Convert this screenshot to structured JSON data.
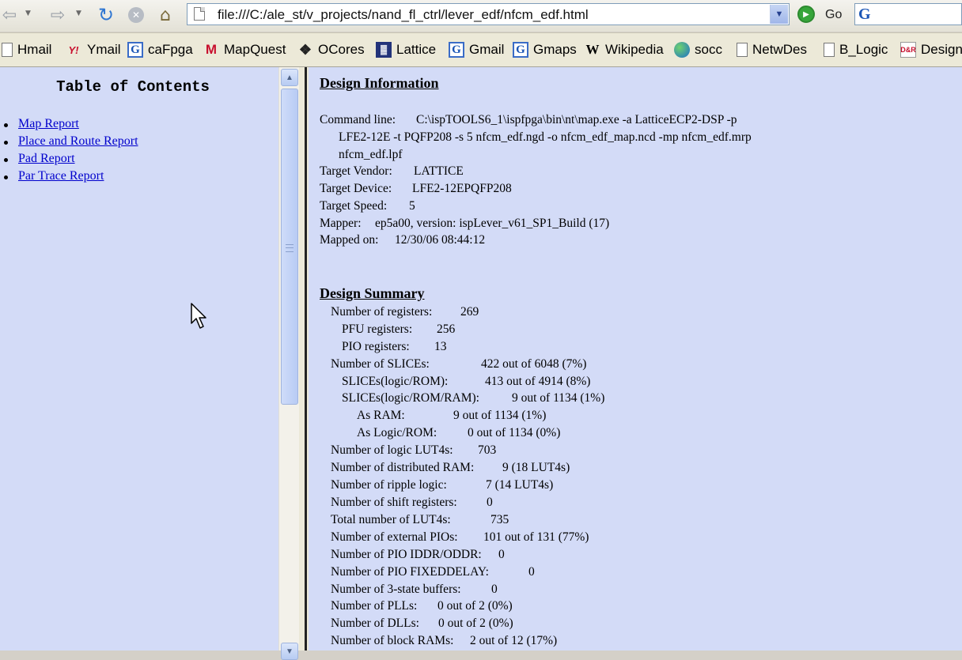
{
  "browser": {
    "url": "file:///C:/ale_st/v_projects/nand_fl_ctrl/lever_edf/nfcm_edf.html",
    "go_label": "Go",
    "back_icon": "back-arrow-icon",
    "forward_icon": "forward-arrow-icon",
    "reload_icon": "reload-icon",
    "stop_icon": "stop-icon",
    "home_icon": "home-icon"
  },
  "bookmarks": [
    {
      "label": "Hmail",
      "icon": "page-icon"
    },
    {
      "label": "Ymail",
      "icon": "yahoo-icon"
    },
    {
      "label": "caFpga",
      "icon": "google-icon"
    },
    {
      "label": "MapQuest",
      "icon": "mapquest-icon"
    },
    {
      "label": "OCores",
      "icon": "opencores-icon"
    },
    {
      "label": "Lattice",
      "icon": "lattice-icon"
    },
    {
      "label": "Gmail",
      "icon": "google-icon"
    },
    {
      "label": "Gmaps",
      "icon": "google-icon"
    },
    {
      "label": "Wikipedia",
      "icon": "wikipedia-icon"
    },
    {
      "label": "socc",
      "icon": "globe-icon"
    },
    {
      "label": "NetwDes",
      "icon": "page-icon"
    },
    {
      "label": "B_Logic",
      "icon": "page-icon"
    },
    {
      "label": "Design",
      "icon": "dr-icon"
    }
  ],
  "toc": {
    "title": "Table of Contents",
    "items": [
      "Map Report",
      "Place and Route Report",
      "Pad Report",
      "Par Trace Report"
    ]
  },
  "design_info": {
    "heading": "Design Information",
    "command_line_label": "Command line:",
    "command_line_1": "C:\\ispTOOLS6_1\\ispfpga\\bin\\nt\\map.exe -a LatticeECP2-DSP -p",
    "command_line_2": "LFE2-12E -t PQFP208 -s 5 nfcm_edf.ngd -o nfcm_edf_map.ncd -mp nfcm_edf.mrp",
    "command_line_3": "nfcm_edf.lpf",
    "vendor_label": "Target Vendor:",
    "vendor": "LATTICE",
    "device_label": "Target Device:",
    "device": "LFE2-12EPQFP208",
    "speed_label": "Target Speed:",
    "speed": "5",
    "mapper_label": "Mapper:",
    "mapper": "ep5a00,  version:  ispLever_v61_SP1_Build (17)",
    "mapped_on_label": "Mapped on:",
    "mapped_on": "12/30/06  08:44:12"
  },
  "design_summary": {
    "heading": "Design Summary",
    "rows": [
      {
        "label": "Number of registers:",
        "value": "269"
      },
      {
        "label": "PFU registers:",
        "value": "256"
      },
      {
        "label": "PIO registers:",
        "value": "13"
      },
      {
        "label": "Number of SLICEs:",
        "value": "422 out of  6048 (7%)"
      },
      {
        "label": "SLICEs(logic/ROM):",
        "value": "413 out of  4914 (8%)"
      },
      {
        "label": "SLICEs(logic/ROM/RAM):",
        "value": "9 out of  1134 (1%)"
      },
      {
        "label": "As RAM:",
        "value": "9 out of  1134 (1%)"
      },
      {
        "label": "As Logic/ROM:",
        "value": "0 out of  1134 (0%)"
      },
      {
        "label": "Number of logic LUT4s:",
        "value": "703"
      },
      {
        "label": "Number of distributed RAM:",
        "value": "9 (18 LUT4s)"
      },
      {
        "label": "Number of ripple logic:",
        "value": "7 (14 LUT4s)"
      },
      {
        "label": "Number of shift registers:",
        "value": "0"
      },
      {
        "label": "Total number of LUT4s:",
        "value": "735"
      },
      {
        "label": "Number of external PIOs:",
        "value": "101 out of 131 (77%)"
      },
      {
        "label": "Number of PIO IDDR/ODDR:",
        "value": "0"
      },
      {
        "label": "Number of PIO FIXEDDELAY:",
        "value": "0"
      },
      {
        "label": "Number of 3-state buffers:",
        "value": "0"
      },
      {
        "label": "Number of PLLs:",
        "value": "0 out of 2 (0%)"
      },
      {
        "label": "Number of DLLs:",
        "value": "0 out of 2 (0%)"
      },
      {
        "label": "Number of block RAMs:",
        "value": "2 out of 12 (17%)"
      }
    ]
  }
}
